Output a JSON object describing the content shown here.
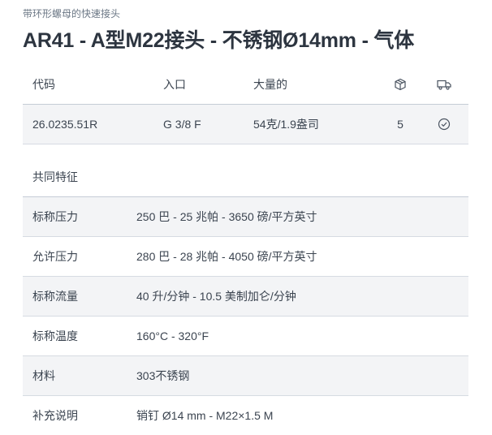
{
  "breadcrumb": "带环形螺母的快速接头",
  "title": "AR41 - A型M22接头 - 不锈钢Ø14mm - 气体",
  "table": {
    "headers": {
      "code": "代码",
      "inlet": "入口",
      "weight": "大量的"
    },
    "header_icons": [
      "box-icon",
      "truck-icon"
    ],
    "rows": [
      {
        "code": "26.0235.51R",
        "inlet": "G 3/8 F",
        "weight": "54克/1.9盎司",
        "qty": "5",
        "status_icon": "check-circle-icon"
      }
    ]
  },
  "features": {
    "title": "共同特征",
    "rows": [
      {
        "label": "标称压力",
        "value": "250 巴 - 25 兆帕 - 3650 磅/平方英寸"
      },
      {
        "label": "允许压力",
        "value": "280 巴 - 28 兆帕 - 4050 磅/平方英寸"
      },
      {
        "label": "标称流量",
        "value": "40 升/分钟 - 10.5 美制加仑/分钟"
      },
      {
        "label": "标称温度",
        "value": "160°C - 320°F"
      },
      {
        "label": "材料",
        "value": "303不锈钢"
      },
      {
        "label": "补充说明",
        "value": "销钉 Ø14 mm - M22×1.5 M"
      }
    ]
  },
  "colors": {
    "title": "#2d3540",
    "text": "#3b4450",
    "row_bg": "#f3f4f6",
    "border": "#c5ccd6"
  }
}
